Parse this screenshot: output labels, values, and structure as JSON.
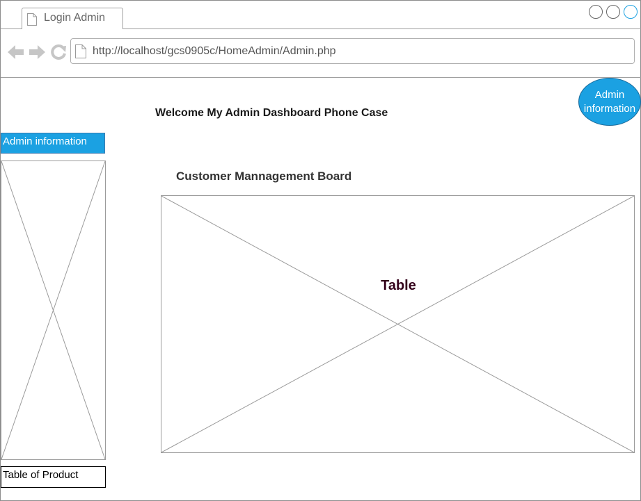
{
  "browser": {
    "tab_title": "Login Admin",
    "url": "http://localhost/gcs0905c/HomeAdmin/Admin.php",
    "icons": {
      "tab": "page-icon",
      "back": "back-arrow-icon",
      "forward": "forward-arrow-icon",
      "reload": "reload-icon",
      "url": "page-icon"
    }
  },
  "header": {
    "welcome": "Welcome My Admin Dashboard Phone Case",
    "admin_circle": "Admin information"
  },
  "sidebar": {
    "admin_button": "Admin information",
    "product_label": "Table of Product"
  },
  "main": {
    "board_title": "Customer Mannagement Board",
    "table_label": "Table"
  },
  "colors": {
    "accent": "#1ba1e2",
    "table_label": "#33001a"
  }
}
